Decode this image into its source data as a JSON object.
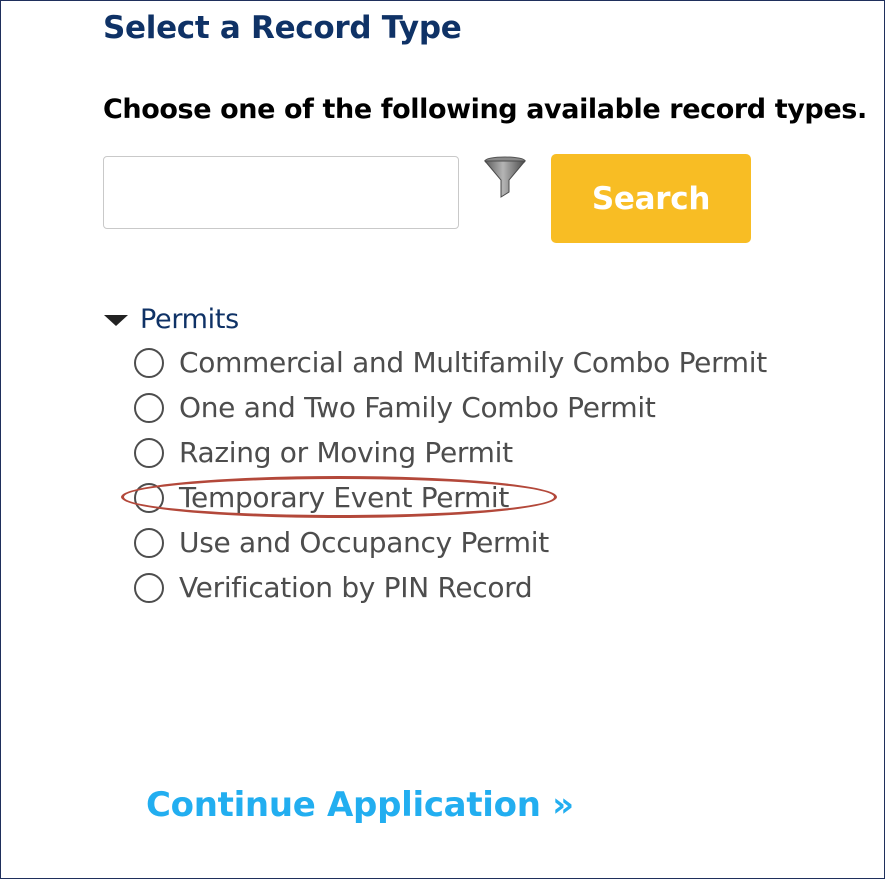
{
  "page": {
    "title": "Select a Record Type",
    "instruction": "Choose one of the following available record types."
  },
  "search": {
    "input_value": "",
    "placeholder": "",
    "filter_icon": "filter-funnel-icon",
    "button_label": "Search",
    "button_color": "#f8bd24"
  },
  "record_types": {
    "group_label": "Permits",
    "expanded": true,
    "options": [
      {
        "label": "Commercial and Multifamily Combo Permit",
        "selected": false
      },
      {
        "label": "One and Two Family Combo Permit",
        "selected": false
      },
      {
        "label": "Razing or Moving Permit",
        "selected": false
      },
      {
        "label": "Temporary Event Permit",
        "selected": false,
        "highlighted": true
      },
      {
        "label": "Use and Occupancy Permit",
        "selected": false
      },
      {
        "label": "Verification by PIN Record",
        "selected": false
      }
    ]
  },
  "actions": {
    "continue_label": "Continue Application »"
  },
  "colors": {
    "title": "#0f3266",
    "link": "#22aef0",
    "highlight_annotation": "#b3483a",
    "border": "#1f2f5c"
  }
}
